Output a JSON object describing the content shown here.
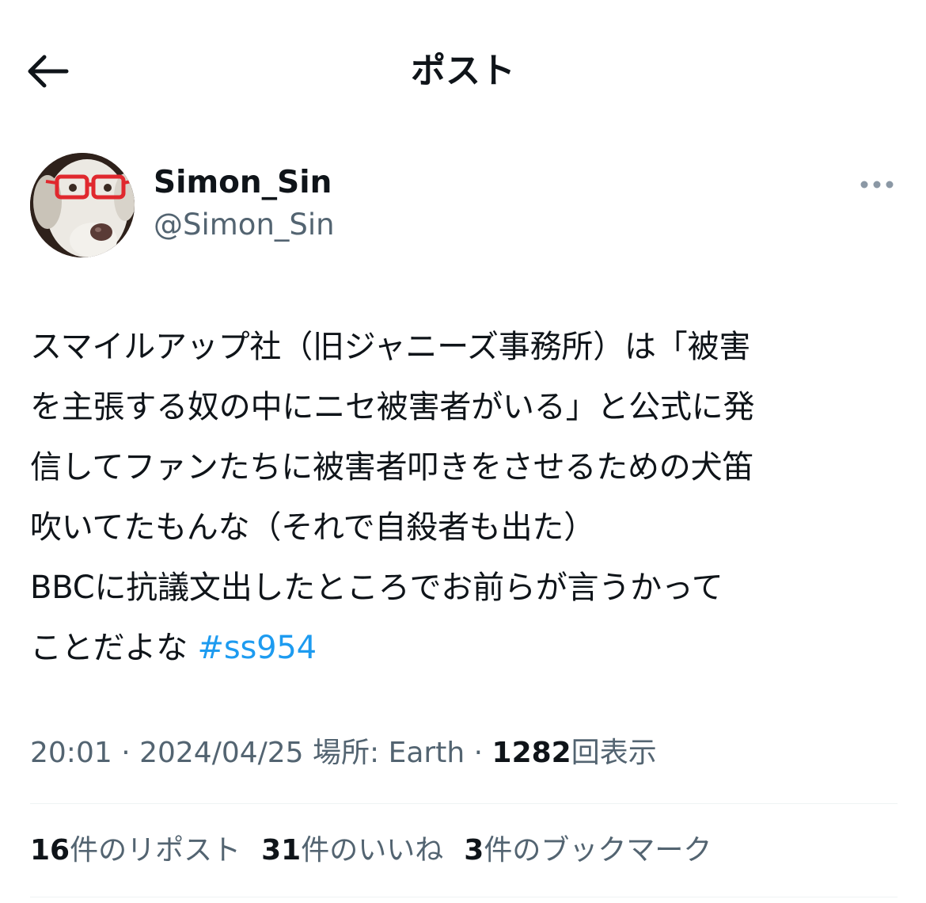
{
  "header": {
    "title": "ポスト",
    "back_icon": "arrow-left-icon"
  },
  "author": {
    "display_name": "Simon_Sin",
    "handle": "@Simon_Sin",
    "avatar": "dog-with-red-glasses-avatar",
    "more_icon": "more-dots-icon"
  },
  "tweet": {
    "text_lines": [
      "スマイルアップ社（旧ジャニーズ事務所）は「被害",
      "を主張する奴の中にニセ被害者がいる」と公式に発",
      "信してファンたちに被害者叩きをさせるための犬笛",
      "吹いてたもんな（それで自殺者も出た）",
      "BBCに抗議文出したところでお前らが言うかって"
    ],
    "last_line_text": "ことだよな ",
    "hashtag": "#ss954"
  },
  "meta": {
    "time": "20:01",
    "separator": " · ",
    "date": "2024/04/25",
    "location": "場所: Earth",
    "views_count": "1282",
    "views_label": "回表示"
  },
  "stats": {
    "reposts_count": "16",
    "reposts_label": "件のリポスト",
    "likes_count": "31",
    "likes_label": "件のいいね",
    "bookmarks_count": "3",
    "bookmarks_label": "件のブックマーク"
  },
  "colors": {
    "text": "#0f1419",
    "secondary": "#536471",
    "link": "#1d9bf0",
    "divider": "#eff3f4",
    "glasses": "#e0282e"
  }
}
